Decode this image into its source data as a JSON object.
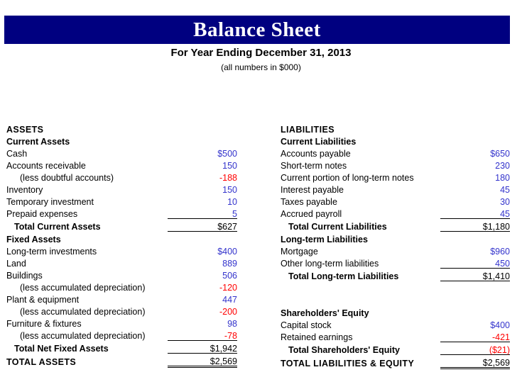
{
  "header": {
    "title": "Balance Sheet",
    "subtitle": "For Year Ending December 31, 2013",
    "note": "(all numbers in $000)",
    "band_color": "#000080",
    "title_color": "#ffffff"
  },
  "colors": {
    "positive": "#3333cc",
    "negative": "#ff0000",
    "text": "#000000"
  },
  "left_column": {
    "section": "ASSETS",
    "rows": [
      {
        "label": "Current Assets",
        "value": "",
        "style": "group"
      },
      {
        "label": "Cash",
        "value": "$500",
        "style": "item",
        "sign": "pos"
      },
      {
        "label": "Accounts receivable",
        "value": "150",
        "style": "item",
        "sign": "pos"
      },
      {
        "label": "(less doubtful accounts)",
        "value": "-188",
        "style": "sub",
        "sign": "neg"
      },
      {
        "label": "Inventory",
        "value": "150",
        "style": "item",
        "sign": "pos"
      },
      {
        "label": "Temporary investment",
        "value": "10",
        "style": "item",
        "sign": "pos"
      },
      {
        "label": "Prepaid expenses",
        "value": "5",
        "style": "item",
        "sign": "pos"
      },
      {
        "label": "Total Current Assets",
        "value": "$627",
        "style": "total",
        "sign": "dark",
        "rule": "both"
      },
      {
        "label": "Fixed Assets",
        "value": "",
        "style": "group"
      },
      {
        "label": "Long-term investments",
        "value": "$400",
        "style": "item",
        "sign": "pos"
      },
      {
        "label": "Land",
        "value": "889",
        "style": "item",
        "sign": "pos"
      },
      {
        "label": "Buildings",
        "value": "506",
        "style": "item",
        "sign": "pos"
      },
      {
        "label": "(less accumulated depreciation)",
        "value": "-120",
        "style": "sub",
        "sign": "neg"
      },
      {
        "label": "Plant & equipment",
        "value": "447",
        "style": "item",
        "sign": "pos"
      },
      {
        "label": "(less accumulated depreciation)",
        "value": "-200",
        "style": "sub",
        "sign": "neg"
      },
      {
        "label": "Furniture & fixtures",
        "value": "98",
        "style": "item",
        "sign": "pos"
      },
      {
        "label": "(less accumulated depreciation)",
        "value": "-78",
        "style": "sub",
        "sign": "neg"
      },
      {
        "label": "Total Net Fixed Assets",
        "value": "$1,942",
        "style": "total",
        "sign": "dark",
        "rule": "top"
      },
      {
        "label": "TOTAL ASSETS",
        "value": "$2,569",
        "style": "grand",
        "sign": "dark",
        "rule": "double"
      }
    ]
  },
  "right_column": {
    "section": "LIABILITIES",
    "rows": [
      {
        "label": "Current Liabilities",
        "value": "",
        "style": "group"
      },
      {
        "label": "Accounts payable",
        "value": "$650",
        "style": "item",
        "sign": "pos"
      },
      {
        "label": "Short-term notes",
        "value": "230",
        "style": "item",
        "sign": "pos"
      },
      {
        "label": "Current portion of long-term notes",
        "value": "180",
        "style": "item",
        "sign": "pos"
      },
      {
        "label": "Interest payable",
        "value": "45",
        "style": "item",
        "sign": "pos"
      },
      {
        "label": "Taxes payable",
        "value": "30",
        "style": "item",
        "sign": "pos"
      },
      {
        "label": "Accrued payroll",
        "value": "45",
        "style": "item",
        "sign": "pos"
      },
      {
        "label": "Total Current Liabilities",
        "value": "$1,180",
        "style": "total",
        "sign": "dark",
        "rule": "both"
      },
      {
        "label": "Long-term Liabilities",
        "value": "",
        "style": "group"
      },
      {
        "label": "Mortgage",
        "value": "$960",
        "style": "item",
        "sign": "pos"
      },
      {
        "label": "Other long-term liabilities",
        "value": "450",
        "style": "item",
        "sign": "pos"
      },
      {
        "label": "Total Long-term Liabilities",
        "value": "$1,410",
        "style": "total",
        "sign": "dark",
        "rule": "both"
      },
      {
        "label": "",
        "value": "",
        "style": "spacer"
      },
      {
        "label": "",
        "value": "",
        "style": "spacer"
      },
      {
        "label": "Shareholders' Equity",
        "value": "",
        "style": "group"
      },
      {
        "label": "Capital stock",
        "value": "$400",
        "style": "item",
        "sign": "pos"
      },
      {
        "label": "Retained earnings",
        "value": "-421",
        "style": "item",
        "sign": "neg"
      },
      {
        "label": "Total Shareholders' Equity",
        "value": "($21)",
        "style": "total",
        "sign": "neg",
        "rule": "top"
      },
      {
        "label": "TOTAL LIABILITIES & EQUITY",
        "value": "$2,569",
        "style": "grand",
        "sign": "dark",
        "rule": "double"
      }
    ]
  }
}
